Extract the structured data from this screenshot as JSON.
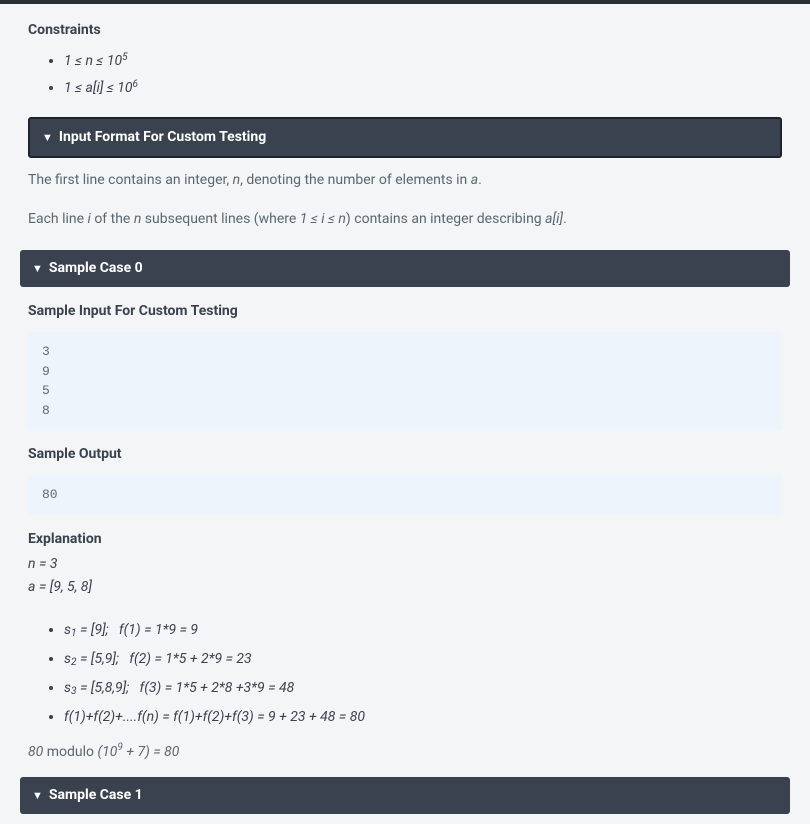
{
  "constraints": {
    "heading": "Constraints",
    "lines": [
      {
        "html": "1 ≤ n ≤ 10<span class=\"sup\">5</span>"
      },
      {
        "html": "1 ≤ a[i] ≤ 10<span class=\"sup\">6</span>"
      }
    ]
  },
  "inputFormat": {
    "title": "Input Format For Custom Testing",
    "body1_html": "The first line contains an integer, <span class=\"it\">n</span>, denoting the number of elements in <span class=\"it\">a</span>.",
    "body2_html": "Each line <span class=\"it\">i</span> of the <span class=\"it\">n</span> subsequent lines (where <span class=\"it\">1 ≤ i ≤ n</span>) contains an integer describing <span class=\"it\">a[i]</span>."
  },
  "sampleCase0": {
    "title": "Sample Case 0",
    "sampleInput": {
      "heading": "Sample Input For Custom Testing",
      "code": "3\n9\n5\n8"
    },
    "sampleOutput": {
      "heading": "Sample Output",
      "code": "80"
    },
    "explanation": {
      "heading": "Explanation",
      "line1_html": "<span class=\"it\">n = 3</span>",
      "line2_html": "<span class=\"it\">a = [9, 5, 8]</span>",
      "calcs": [
        {
          "html": "s<span class=\"sub\">1</span> = [9];&nbsp;&nbsp; f(1) = 1*9 = 9"
        },
        {
          "html": "s<span class=\"sub\">2</span> = [5,9];&nbsp;&nbsp; f(2) = 1*5 + 2*9 = 23"
        },
        {
          "html": "s<span class=\"sub\">3</span> = [5,8,9];&nbsp;&nbsp; f(3) = 1*5 + 2*8 +3*9 = 48"
        },
        {
          "html": "f(1)+f(2)+....f(n) = f(1)+f(2)+f(3) = 9 + 23 + 48 = 80"
        }
      ],
      "modulo_html": "<span class=\"it\">80</span> modulo <span class=\"it\">(10<span class=\"sup\">9</span> + 7) = 80</span>"
    }
  },
  "sampleCase1": {
    "title": "Sample Case 1"
  }
}
